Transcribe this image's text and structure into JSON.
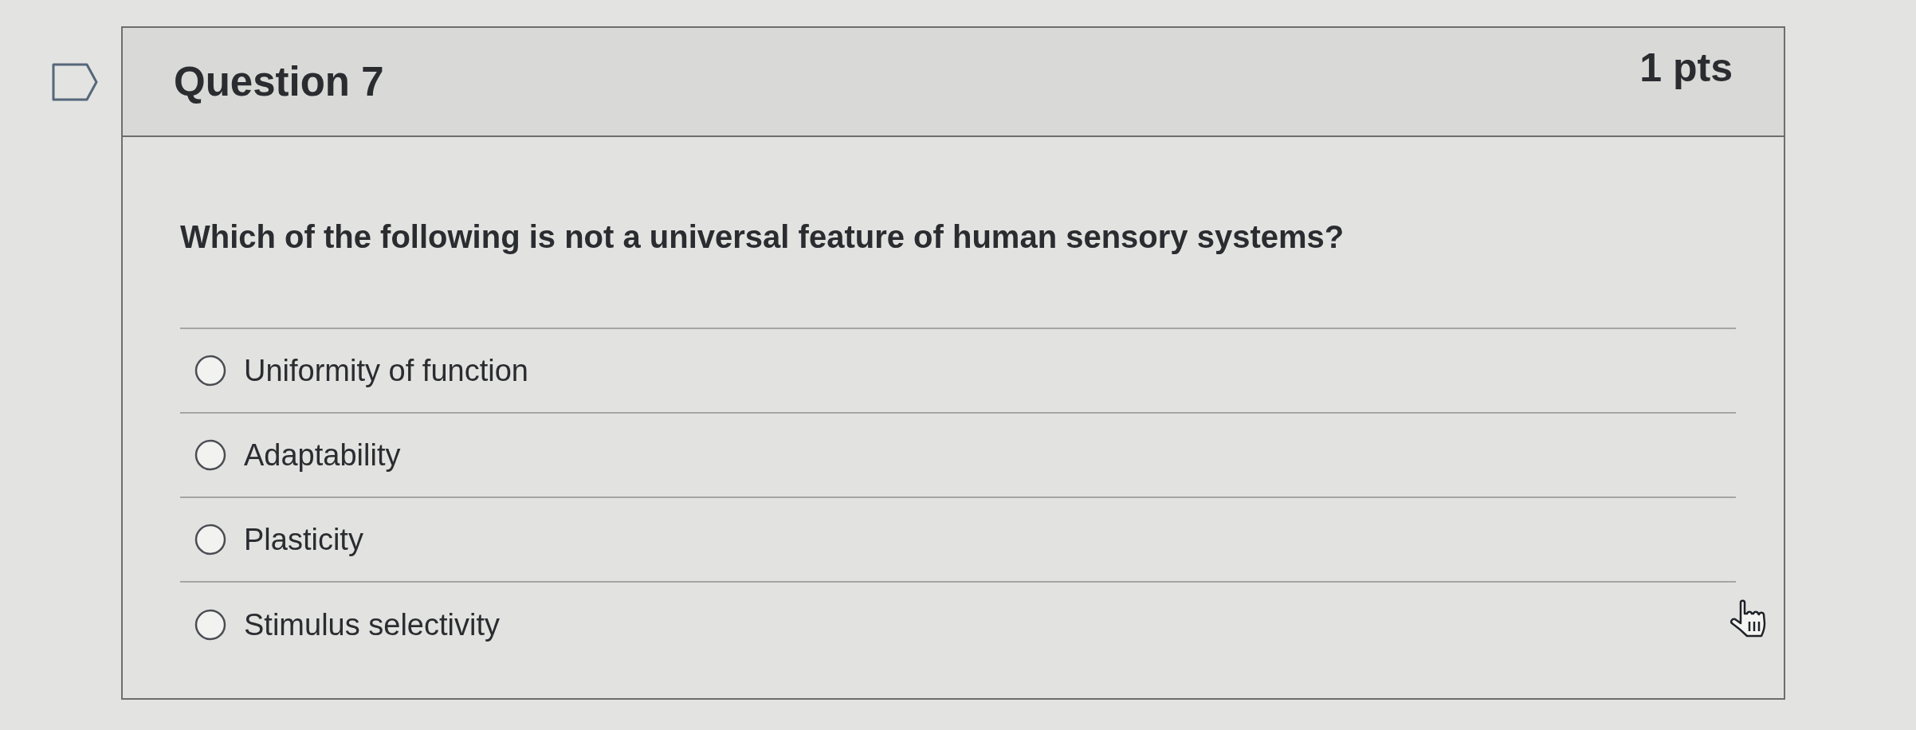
{
  "flag": {
    "flagged": false
  },
  "question": {
    "title": "Question 7",
    "points": "1 pts",
    "text": "Which of the following is not a universal feature of human sensory systems?",
    "options": [
      {
        "label": "Uniformity of function",
        "selected": false
      },
      {
        "label": "Adaptability",
        "selected": false
      },
      {
        "label": "Plasticity",
        "selected": false
      },
      {
        "label": "Stimulus selectivity",
        "selected": false
      }
    ]
  }
}
